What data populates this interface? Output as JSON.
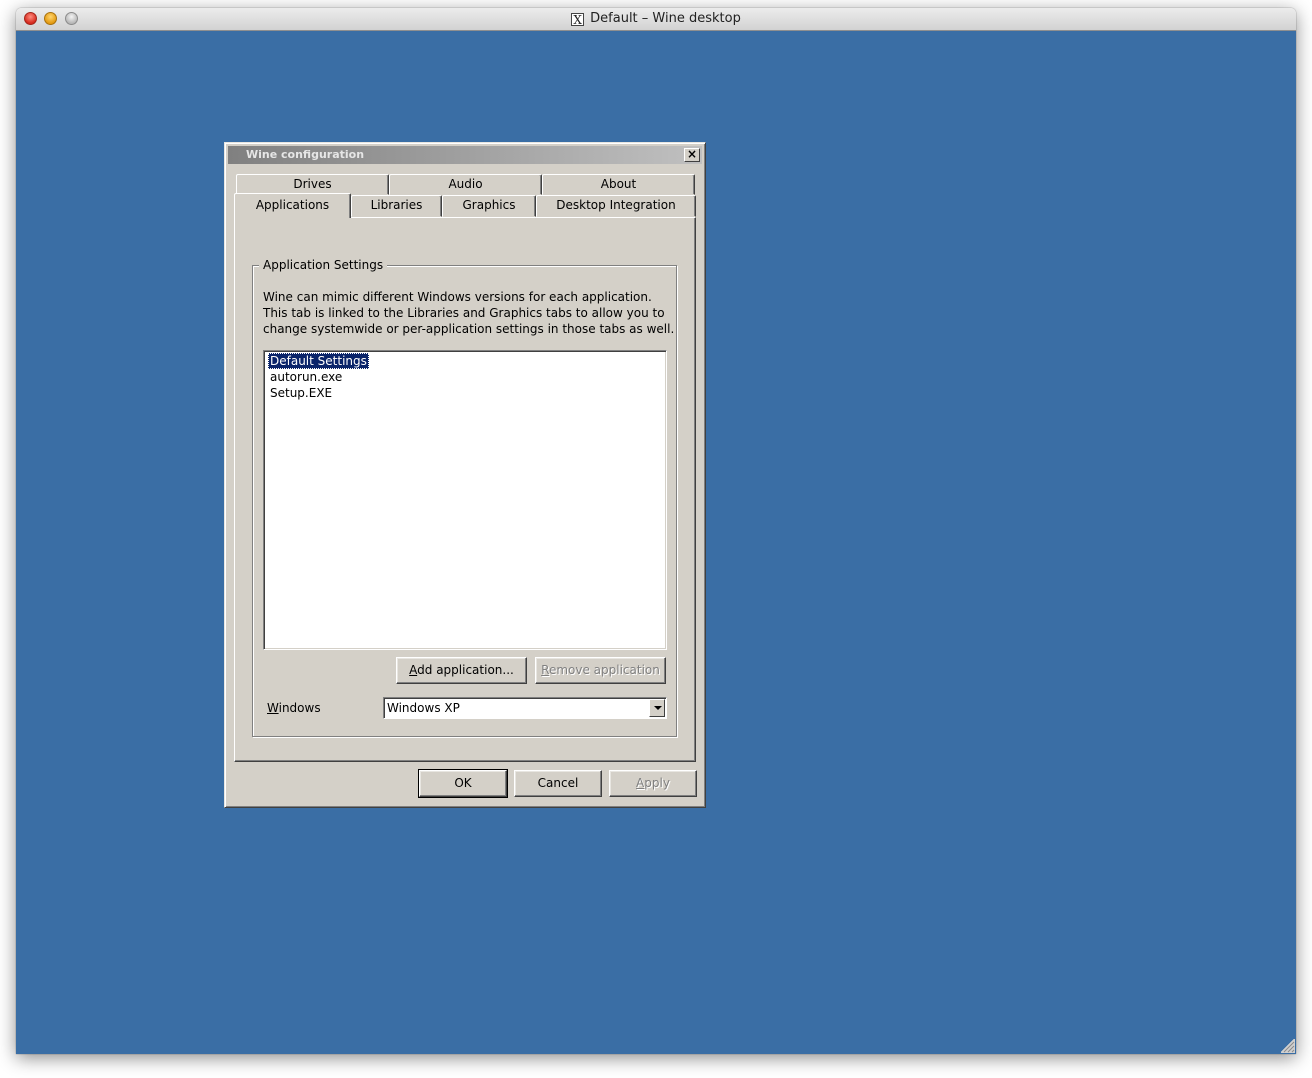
{
  "window": {
    "title": "Default – Wine desktop",
    "x_glyph": "X",
    "desktop_color": "#3a6ea5"
  },
  "dialog": {
    "title": "Wine configuration",
    "close_glyph": "×",
    "tabs_row1": [
      "Drives",
      "Audio",
      "About"
    ],
    "tabs_row2": [
      "Applications",
      "Libraries",
      "Graphics",
      "Desktop Integration"
    ],
    "active_tab": "Applications",
    "group_label": "Application Settings",
    "description_lines": [
      "Wine can mimic different Windows versions for each application.",
      "This tab is linked to the Libraries and Graphics tabs to allow you to",
      "change systemwide or per-application settings in those tabs as well."
    ],
    "applications": [
      "Default Settings",
      "autorun.exe",
      "Setup.EXE"
    ],
    "selected_application": "Default Settings",
    "add_button": {
      "mnemonic": "A",
      "rest": "dd application..."
    },
    "remove_button": {
      "mnemonic": "R",
      "rest": "emove application",
      "disabled": true
    },
    "windows_label": {
      "mnemonic": "W",
      "rest": "indows"
    },
    "windows_version": "Windows XP",
    "ok_label": "OK",
    "cancel_label": "Cancel",
    "apply_button": {
      "mnemonic": "A",
      "rest": "pply",
      "disabled": true
    }
  }
}
